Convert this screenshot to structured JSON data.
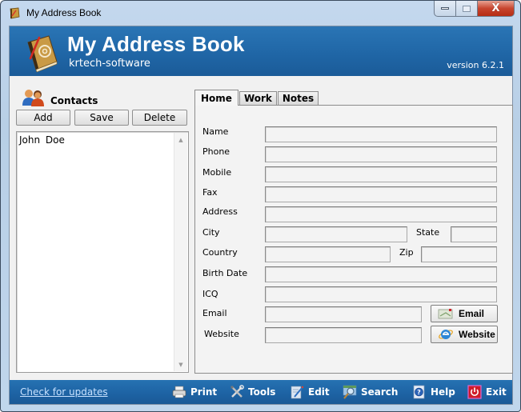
{
  "window": {
    "title": "My Address Book",
    "close_glyph": "X"
  },
  "header": {
    "title": "My Address Book",
    "subtitle": "krtech-software",
    "version": "version 6.2.1"
  },
  "contacts": {
    "label": "Contacts",
    "buttons": {
      "add": "Add",
      "save": "Save",
      "delete": "Delete"
    },
    "items": [
      {
        "name": "John  Doe"
      }
    ],
    "scroll_up": "▲",
    "scroll_down": "▼"
  },
  "tabs": [
    {
      "label": "Home",
      "active": true
    },
    {
      "label": "Work",
      "active": false
    },
    {
      "label": "Notes",
      "active": false
    }
  ],
  "form": {
    "name": {
      "label": "Name",
      "value": ""
    },
    "phone": {
      "label": "Phone",
      "value": ""
    },
    "mobile": {
      "label": "Mobile",
      "value": ""
    },
    "fax": {
      "label": "Fax",
      "value": ""
    },
    "address": {
      "label": "Address",
      "value": ""
    },
    "city": {
      "label": "City",
      "value": ""
    },
    "state": {
      "label": "State",
      "value": ""
    },
    "country": {
      "label": "Country",
      "value": ""
    },
    "zip": {
      "label": "Zip",
      "value": ""
    },
    "birth_date": {
      "label": "Birth Date",
      "value": ""
    },
    "icq": {
      "label": "ICQ",
      "value": ""
    },
    "email": {
      "label": "Email",
      "value": ""
    },
    "website": {
      "label": "Website",
      "value": ""
    },
    "email_button": "Email",
    "website_button": "Website"
  },
  "footer": {
    "update_link": "Check for updates",
    "toolbar": [
      {
        "id": "print",
        "label": "Print",
        "icon": "printer-icon"
      },
      {
        "id": "tools",
        "label": "Tools",
        "icon": "tools-icon"
      },
      {
        "id": "edit",
        "label": "Edit",
        "icon": "edit-icon"
      },
      {
        "id": "search",
        "label": "Search",
        "icon": "search-icon"
      },
      {
        "id": "help",
        "label": "Help",
        "icon": "help-icon"
      },
      {
        "id": "exit",
        "label": "Exit",
        "icon": "power-icon"
      }
    ]
  }
}
